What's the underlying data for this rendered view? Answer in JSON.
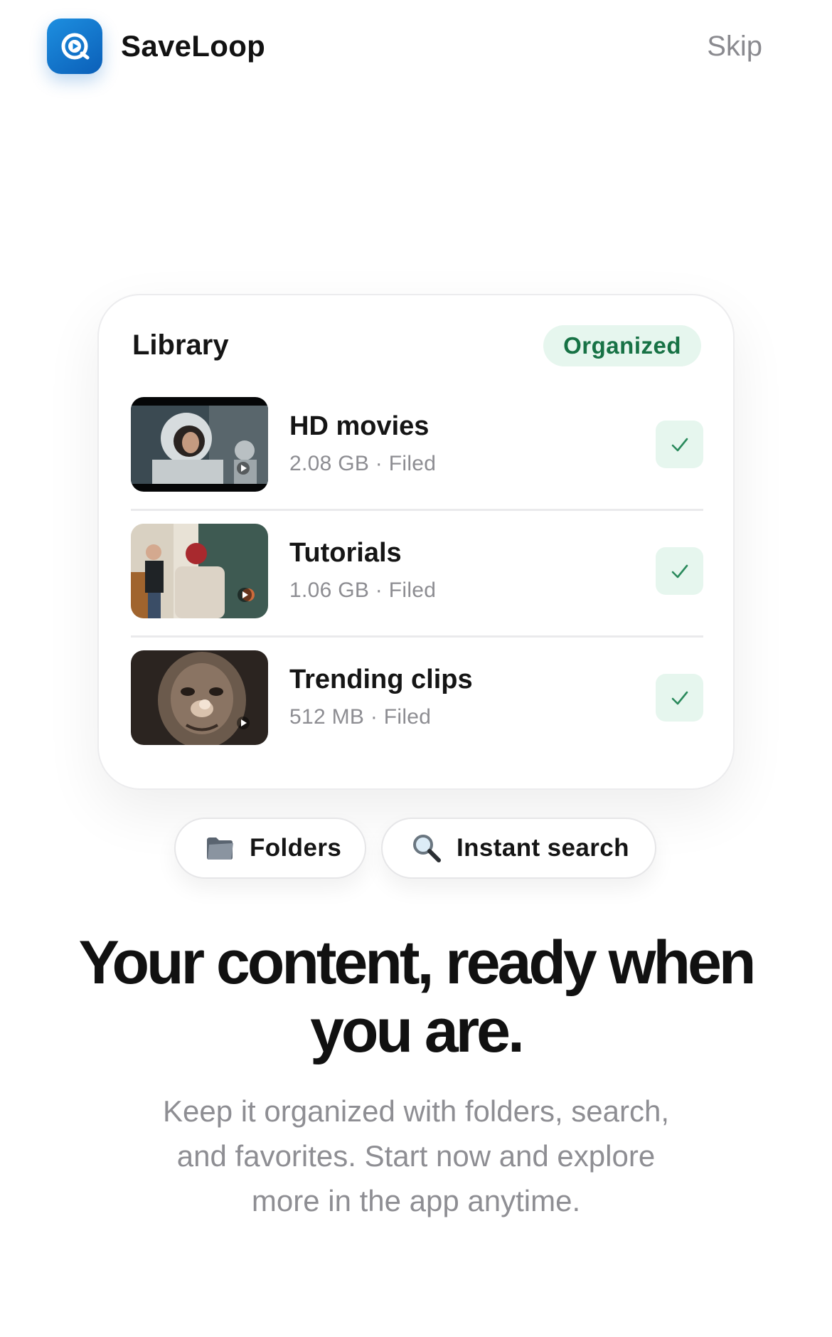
{
  "header": {
    "app_name": "SaveLoop",
    "skip_label": "Skip",
    "icon": "app-logo-icon",
    "brand_color": "#1280d6"
  },
  "library": {
    "title": "Library",
    "badge": "Organized",
    "items": [
      {
        "title": "HD movies",
        "meta": "2.08 GB · Filed",
        "thumb": "astronaut-thumbnail",
        "status": "checked"
      },
      {
        "title": "Tutorials",
        "meta": "1.06 GB · Filed",
        "thumb": "classroom-thumbnail",
        "status": "checked"
      },
      {
        "title": "Trending clips",
        "meta": "512 MB · Filed",
        "thumb": "creature-face-thumbnail",
        "status": "checked"
      }
    ]
  },
  "features": {
    "folders": {
      "label": "Folders",
      "icon": "folder-icon"
    },
    "search": {
      "label": "Instant search",
      "icon": "magnifier-icon"
    }
  },
  "hero": {
    "headline_line1": "Your content, ready when",
    "headline_line2": "you are.",
    "body_line1": "Keep it organized with folders, search,",
    "body_line2": "and favorites. Start now and explore",
    "body_line3": "more in the app anytime."
  },
  "colors": {
    "badge_bg": "#e6f6ee",
    "badge_text": "#177245",
    "muted_text": "#8e8e93"
  }
}
